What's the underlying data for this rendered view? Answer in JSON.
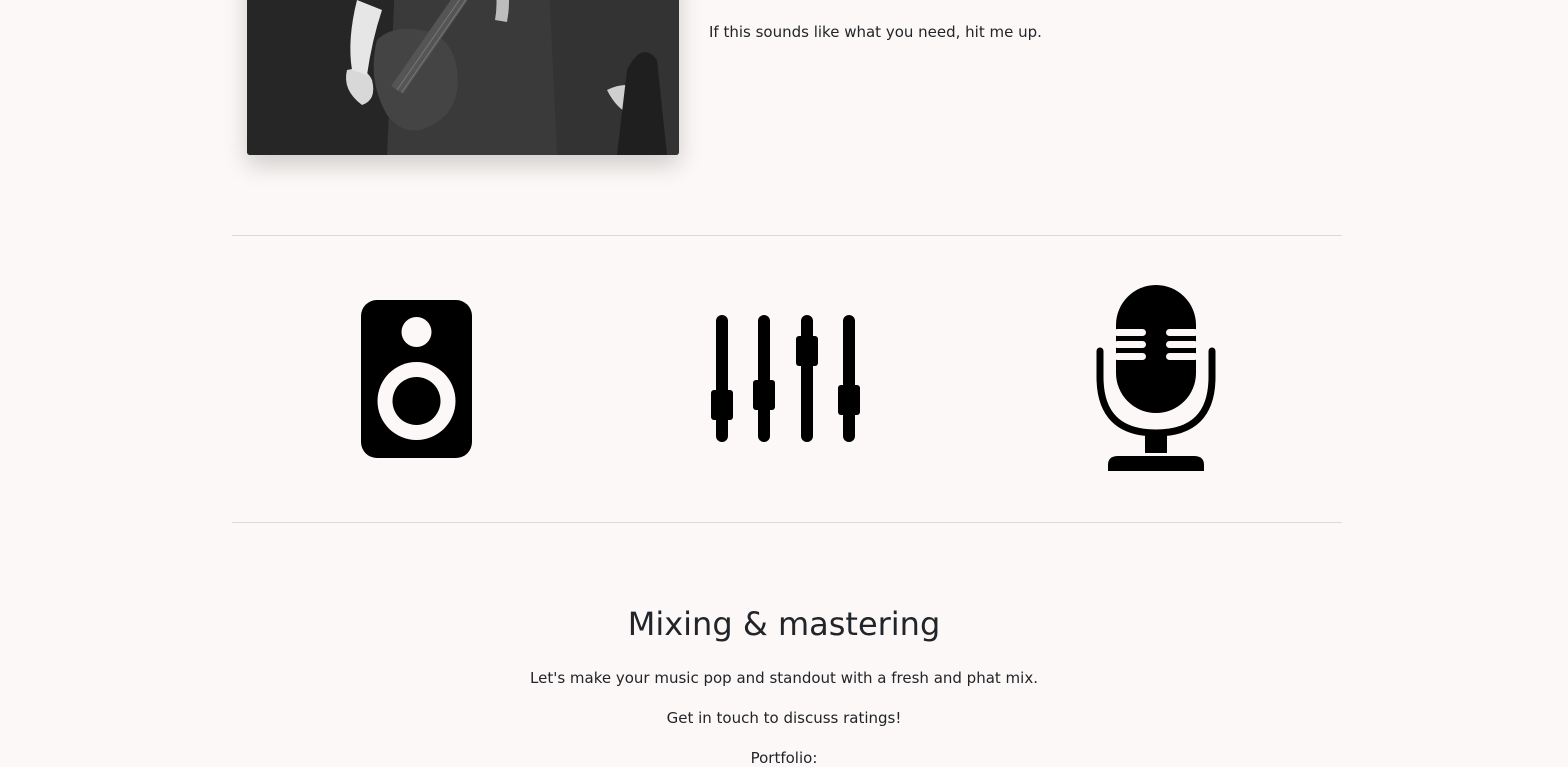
{
  "intro": {
    "cta_text": "If this sounds like what you need, hit me up."
  },
  "icons": {
    "speaker": "speaker-icon",
    "mixer": "mixer-sliders-icon",
    "microphone": "microphone-icon"
  },
  "mixing_section": {
    "title": "Mixing & mastering",
    "paragraph_1": "Let's make your music pop and standout with a fresh and phat mix.",
    "paragraph_2": "Get in touch to discuss ratings!",
    "paragraph_3": "Portfolio:"
  },
  "colors": {
    "background": "#fcf8f7",
    "text": "#212529",
    "icon": "#000000",
    "divider": "#dedad9"
  }
}
